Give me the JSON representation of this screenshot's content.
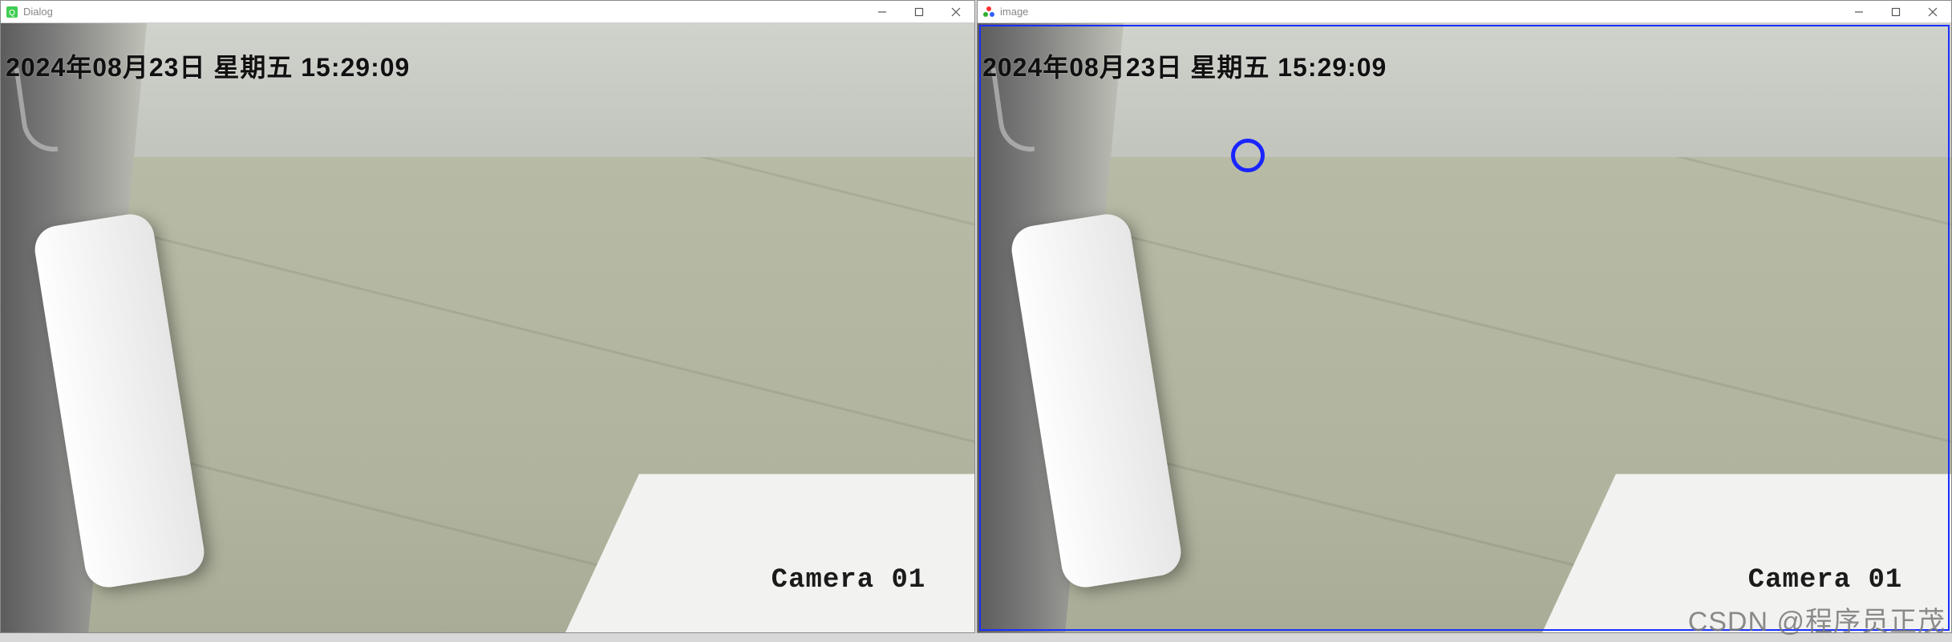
{
  "windows": {
    "dialog": {
      "title": "Dialog",
      "icon_name": "qt-app-icon"
    },
    "image": {
      "title": "image",
      "icon_name": "opencv-app-icon"
    }
  },
  "video": {
    "timestamp": "2024年08月23日 星期五 15:29:09",
    "camera_label": "Camera 01"
  },
  "detection": {
    "marker_shape": "circle",
    "marker_color": "#1a24ff"
  },
  "watermark": "CSDN @程序员正茂"
}
